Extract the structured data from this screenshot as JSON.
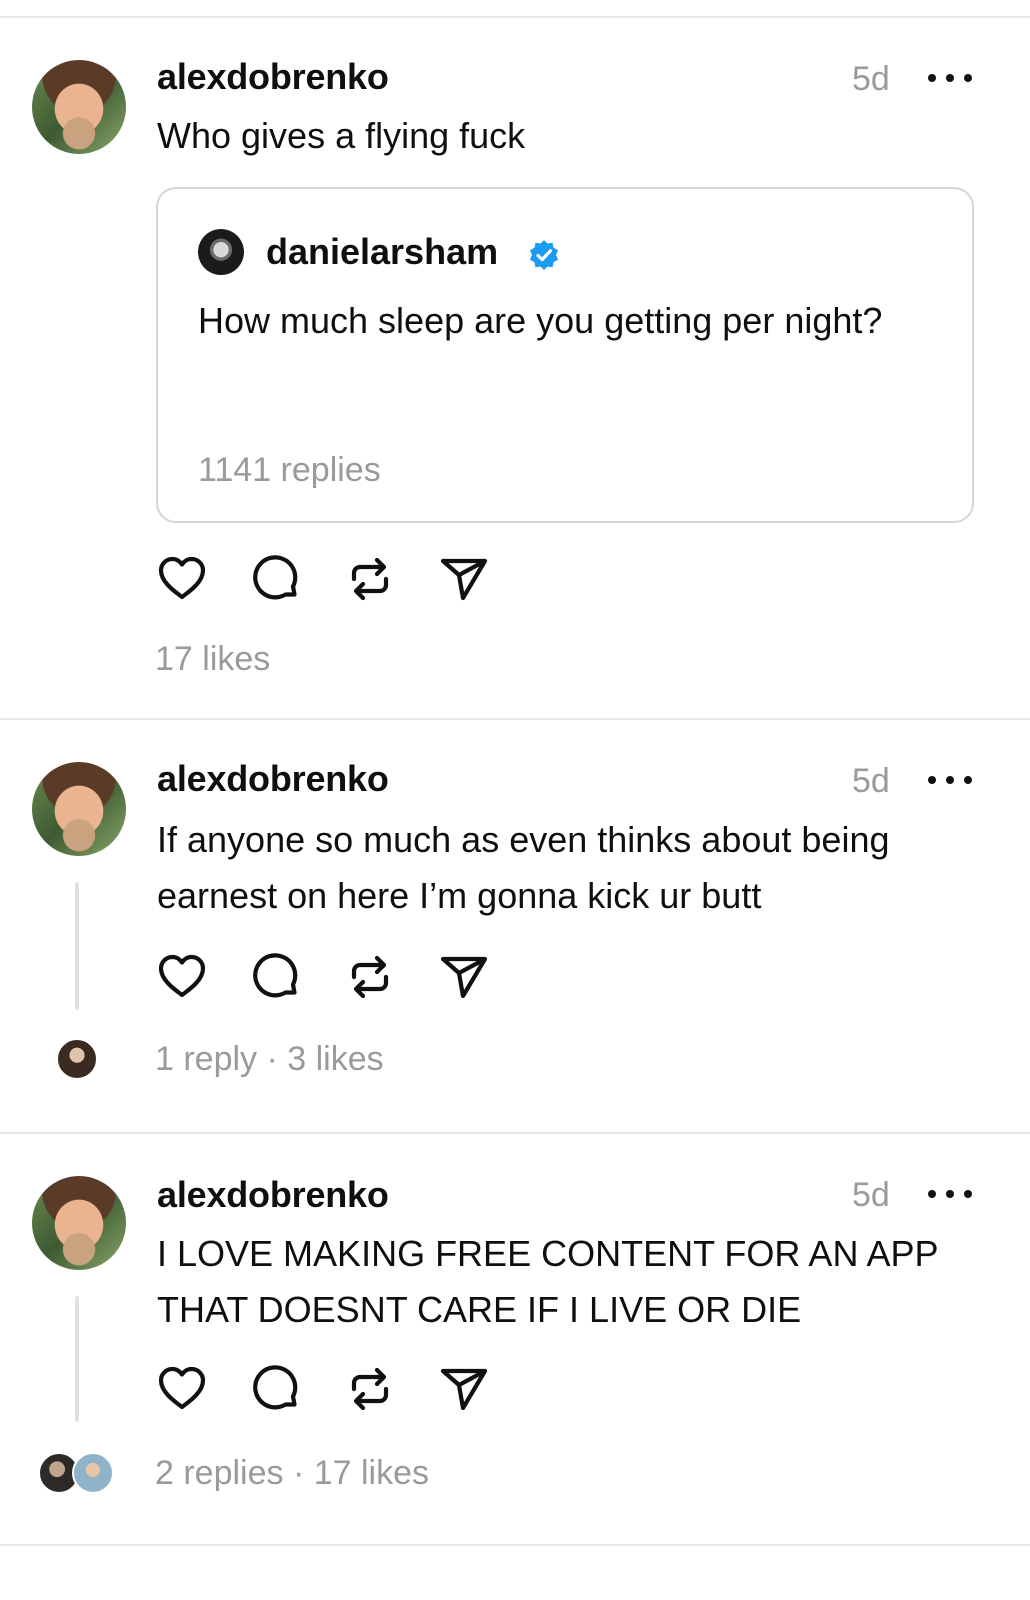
{
  "posts": [
    {
      "username": "alexdobrenko",
      "time": "5d",
      "text": "Who gives a flying fuck",
      "quote": {
        "username": "danielarsham",
        "verified": true,
        "text": "How much sleep are you getting per night?",
        "replies": "1141 replies"
      },
      "stats": "17 likes"
    },
    {
      "username": "alexdobrenko",
      "time": "5d",
      "text": "If anyone so much as even thinks about being earnest on here I’m gonna kick ur butt",
      "stats": "1 reply · 3 likes"
    },
    {
      "username": "alexdobrenko",
      "time": "5d",
      "text": "I LOVE MAKING FREE CONTENT FOR AN APP THAT DOESNT CARE IF I LIVE OR DIE",
      "stats": "2 replies · 17 likes"
    }
  ],
  "icons": [
    "heart-icon",
    "comment-icon",
    "repost-icon",
    "share-icon",
    "more-icon",
    "verified-icon"
  ],
  "colors": {
    "verified": "#1d9bf0",
    "muted": "#9a9a9a",
    "divider": "#e8e8e8"
  }
}
